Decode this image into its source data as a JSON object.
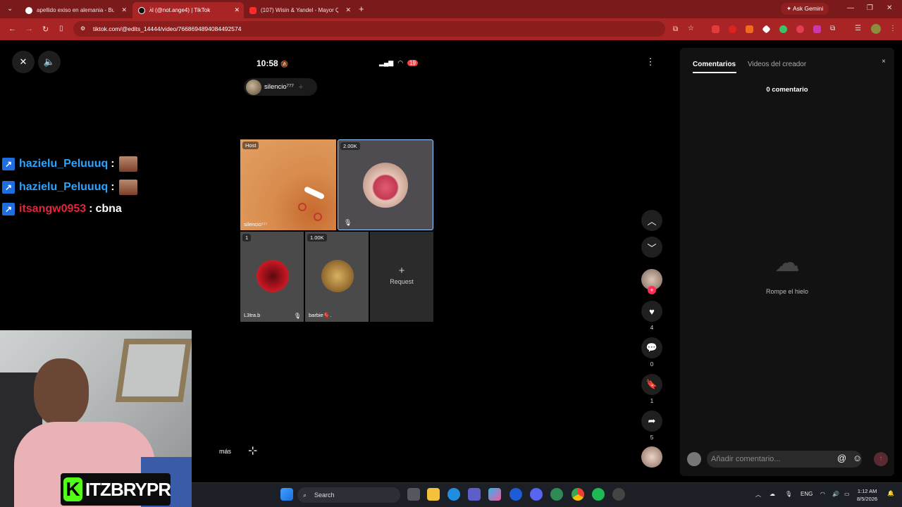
{
  "browser": {
    "tabs": [
      {
        "title": "apellido exiso en alemania - Bu",
        "active": false,
        "favicon": "google-icon"
      },
      {
        "title": "ʌ̇l (@not.ange4) | TikTok",
        "active": true,
        "favicon": "tiktok-icon"
      },
      {
        "title": "(107) Wisin & Yandel - Mayor Q",
        "active": false,
        "favicon": "youtube-icon"
      }
    ],
    "new_tab": "+",
    "ask_gemini": "Ask Gemini",
    "url": "tiktok.com/@edits_14444/video/7668694894084492574",
    "accent": "#a92424"
  },
  "video": {
    "phone_time": "10:58",
    "battery": "19",
    "host_name": "silencio⁷⁷⁷",
    "tiles": {
      "host_badge": "Host",
      "host_label": "silencio⁷⁷⁷",
      "top_right_badge": "2.00K",
      "bottom1_badge": "1",
      "bottom1_label": "L3tra.b",
      "bottom2_badge": "1.00K",
      "bottom2_label": "barbie🫀.",
      "request_plus": "+",
      "request_label": "Request"
    },
    "more_text": "más"
  },
  "chat": [
    {
      "user": "hazielu_Peluuuq",
      "sep": ":",
      "text": "",
      "color": "#2aa4ff"
    },
    {
      "user": "hazielu_Peluuuq",
      "sep": ":",
      "text": "",
      "color": "#2aa4ff"
    },
    {
      "user": "itsangw0953",
      "sep": ":",
      "text": "cbna",
      "color": "#e0263a"
    }
  ],
  "actions": {
    "likes": "4",
    "comments": "0",
    "saves": "1",
    "shares": "5"
  },
  "panel": {
    "tab_comments": "Comentarios",
    "tab_creator": "Videos del creador",
    "count": "0 comentario",
    "empty_text": "Rompe el hielo",
    "input_placeholder": "Añadir comentario...",
    "close": "×"
  },
  "streamer": {
    "brand_letter": "K",
    "brand_text": "ITZBRYPR"
  },
  "taskbar": {
    "search": "Search",
    "lang": "ENG",
    "time": "1:12 AM",
    "date": "8/5/2026"
  }
}
